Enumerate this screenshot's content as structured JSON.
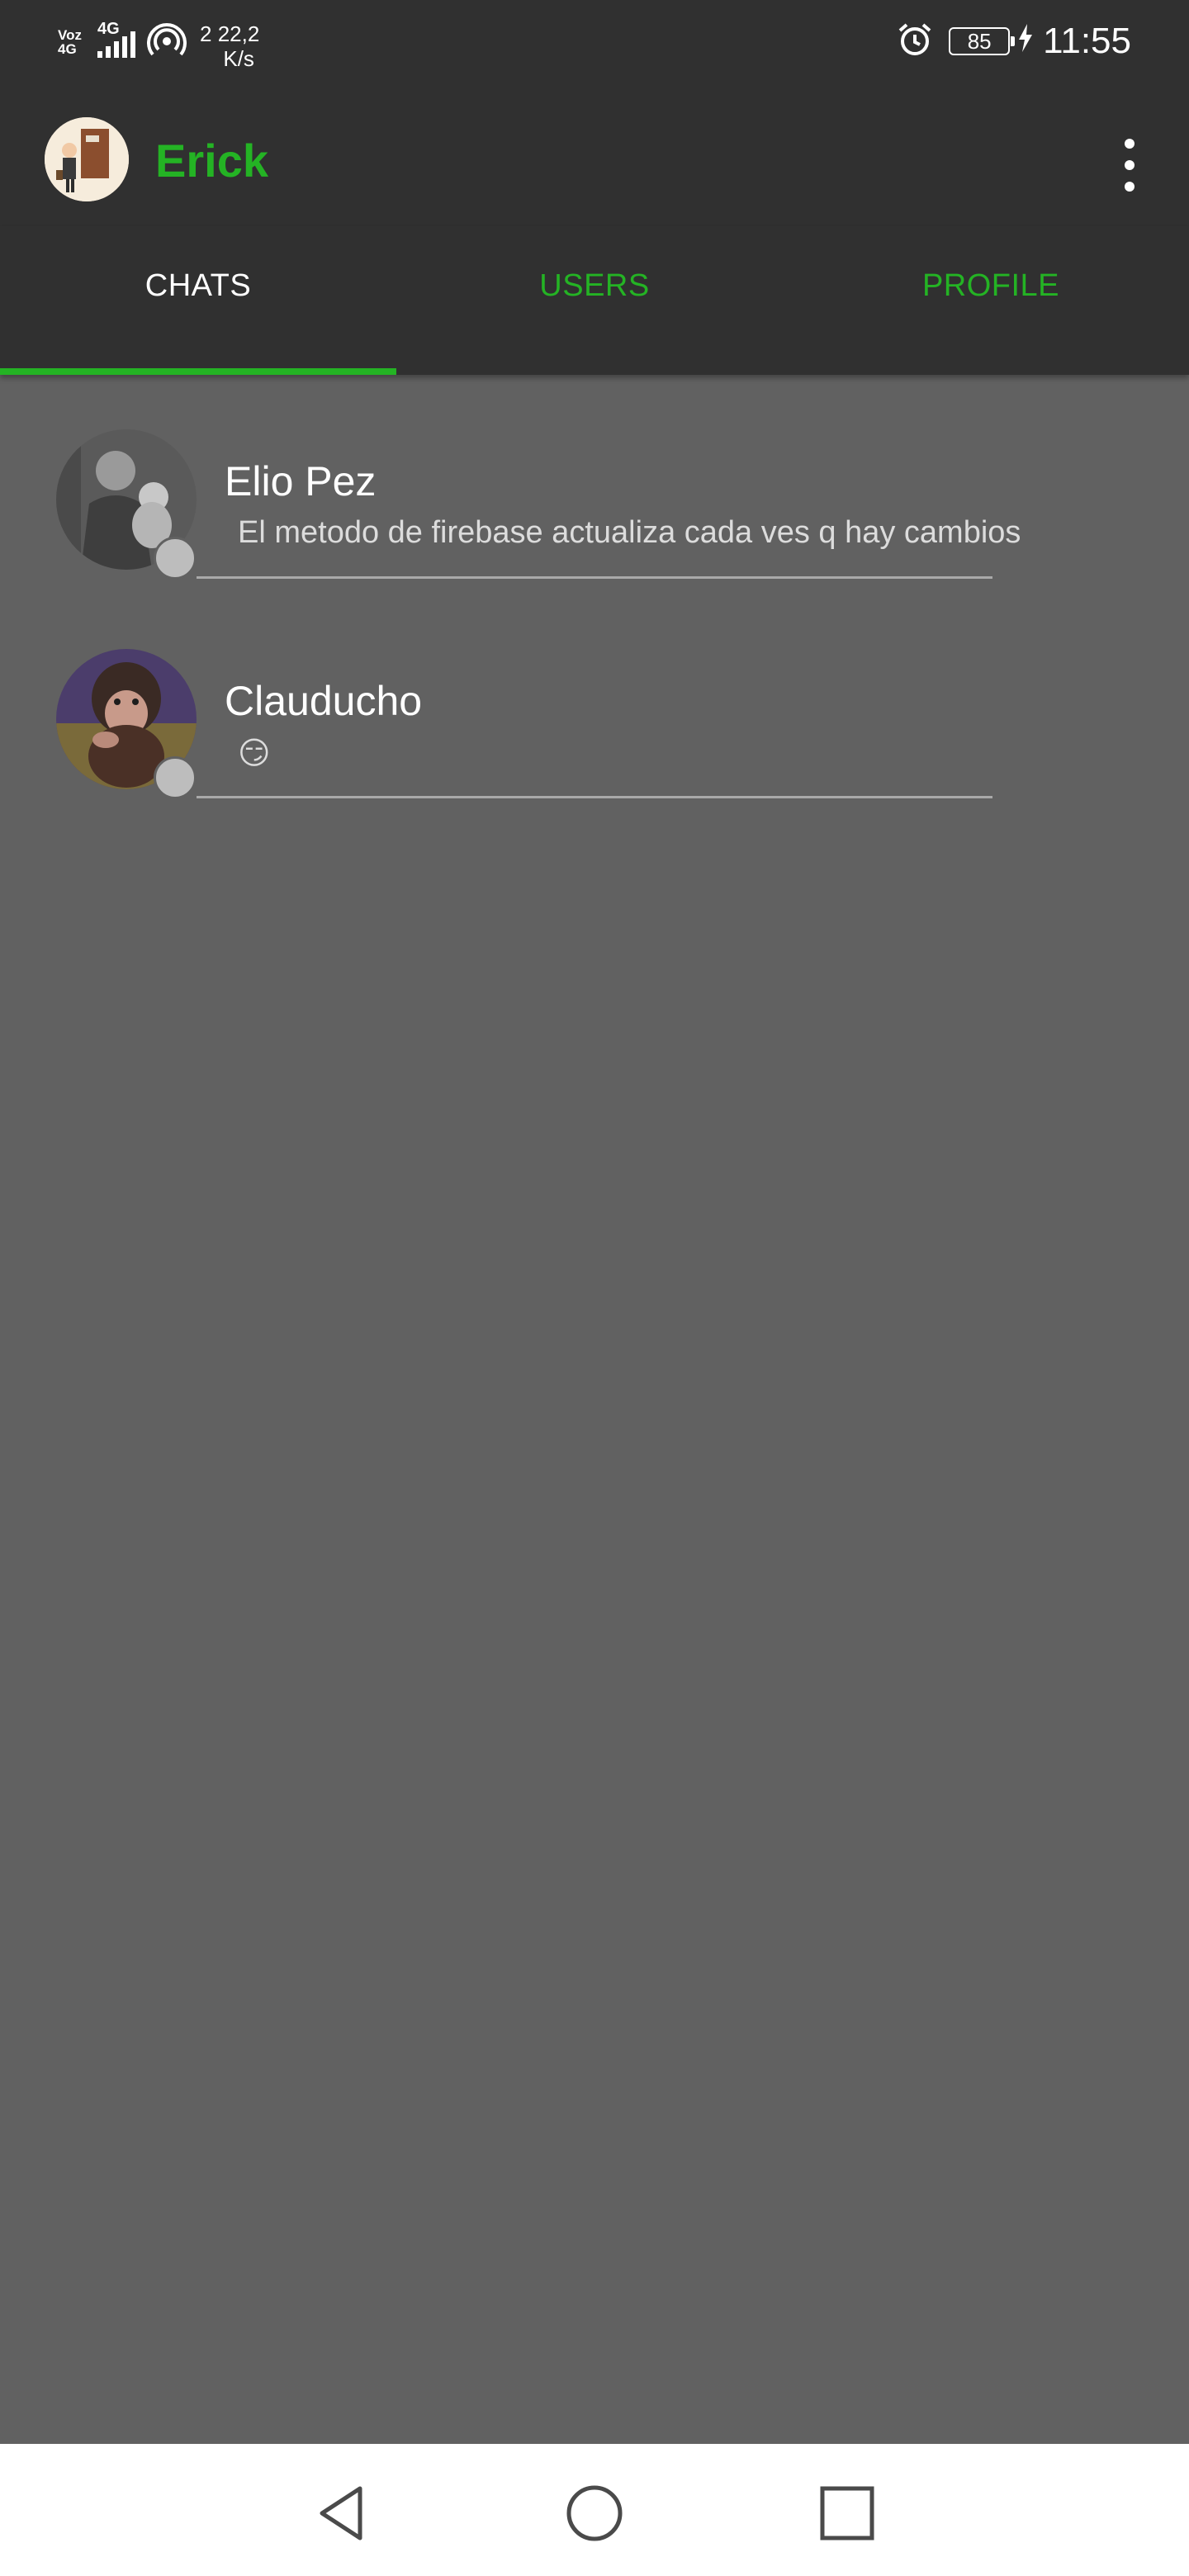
{
  "status_bar": {
    "carrier_label": "Voz 4G",
    "network_type": "4G",
    "data_rate_prefix": "2",
    "data_rate_value": "22,2",
    "data_rate_unit": "K/s",
    "battery": "85",
    "time": "11:55",
    "icons": [
      "signal-bars-icon",
      "hotspot-icon",
      "alarm-clock-icon",
      "battery-icon",
      "charging-bolt-icon"
    ]
  },
  "app_bar": {
    "title": "Erick",
    "title_color": "#24b324",
    "avatar": "profile-avatar",
    "menu_icon": "overflow-menu-icon"
  },
  "tabs": [
    {
      "label": "CHATS",
      "active": true
    },
    {
      "label": "USERS",
      "active": false
    },
    {
      "label": "PROFILE",
      "active": false
    }
  ],
  "chats": [
    {
      "name": "Elio Pez",
      "last_message": "El metodo de firebase actualiza cada ves q hay cambios",
      "status": "offline"
    },
    {
      "name": "Clauducho",
      "last_message": "😏",
      "status": "offline"
    }
  ],
  "nav_bar": {
    "icons": [
      "back-icon",
      "home-icon",
      "recents-icon"
    ]
  },
  "colors": {
    "accent": "#24b324",
    "bar_background": "#303030",
    "list_background": "#616161",
    "status_dot": "#bdbdbd"
  }
}
